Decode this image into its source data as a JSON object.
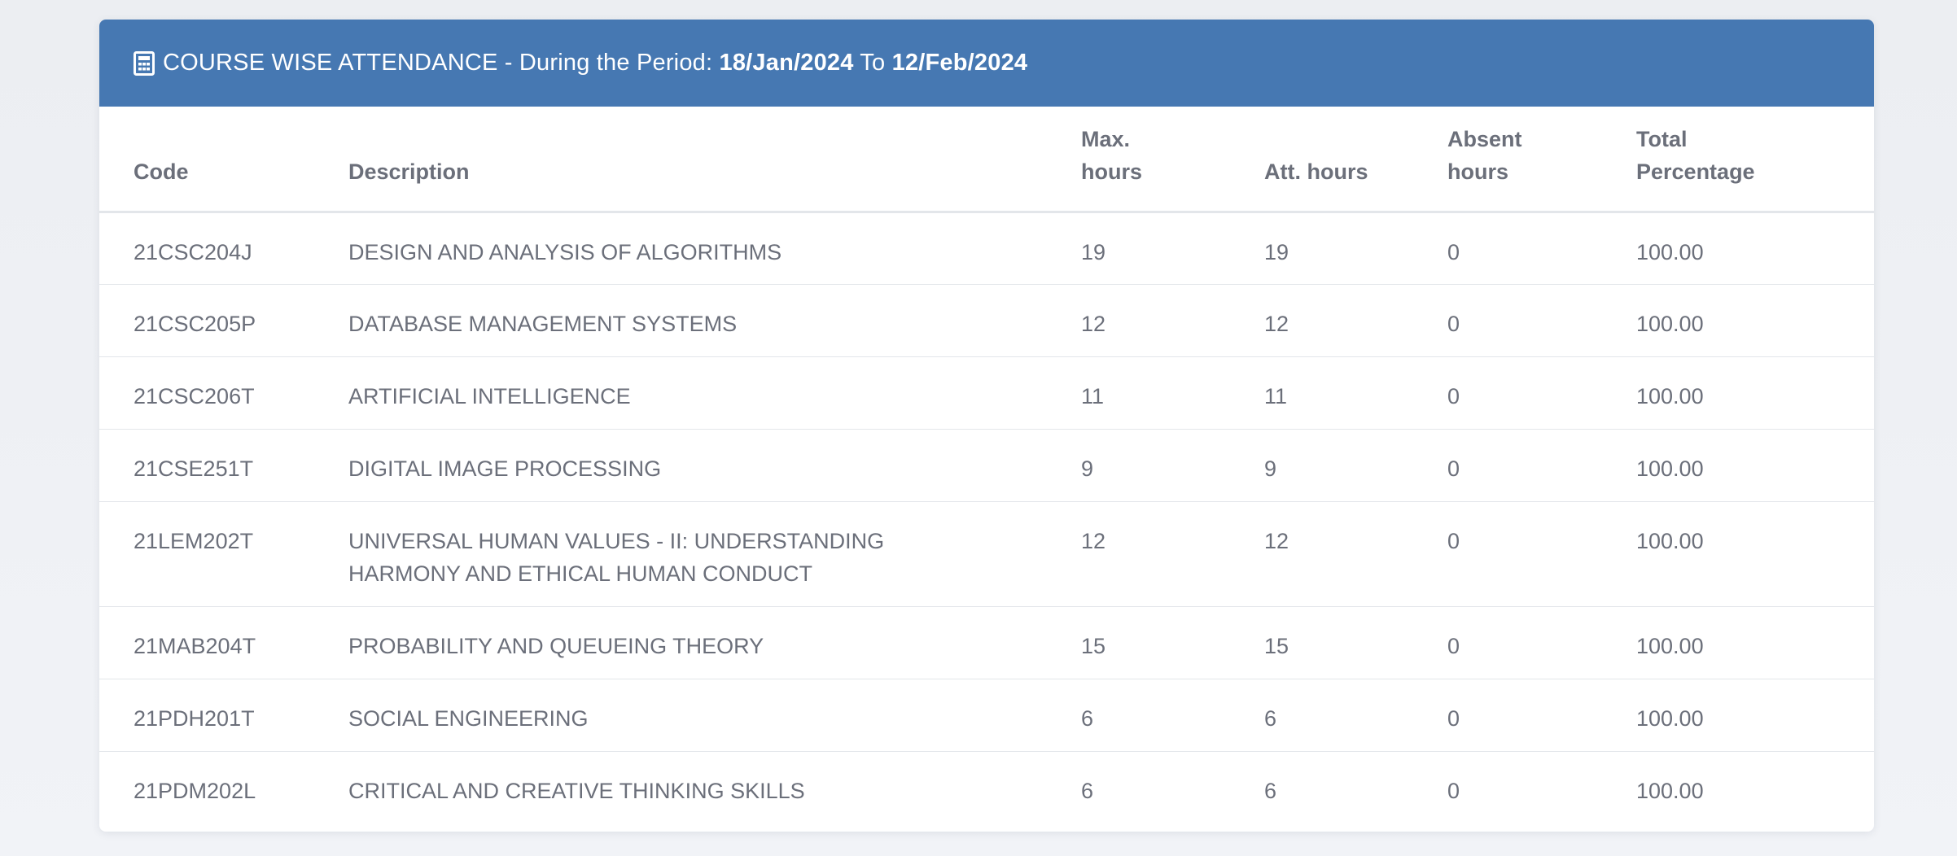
{
  "header": {
    "icon": "calculator-icon",
    "title_prefix": "COURSE WISE ATTENDANCE - During the Period: ",
    "from_date": "18/Jan/2024",
    "to_label": " To ",
    "to_date": "12/Feb/2024",
    "background_color": "#4678b2"
  },
  "table": {
    "columns": {
      "code": "Code",
      "description": "Description",
      "max_hours": "Max. hours",
      "att_hours": "Att. hours",
      "absent_hours": "Absent hours",
      "total_percentage": "Total Percentage"
    },
    "rows": [
      {
        "code": "21CSC204J",
        "description": "DESIGN AND ANALYSIS OF ALGORITHMS",
        "max_hours": "19",
        "att_hours": "19",
        "absent_hours": "0",
        "total_percentage": "100.00"
      },
      {
        "code": "21CSC205P",
        "description": "DATABASE MANAGEMENT SYSTEMS",
        "max_hours": "12",
        "att_hours": "12",
        "absent_hours": "0",
        "total_percentage": "100.00"
      },
      {
        "code": "21CSC206T",
        "description": "ARTIFICIAL INTELLIGENCE",
        "max_hours": "11",
        "att_hours": "11",
        "absent_hours": "0",
        "total_percentage": "100.00"
      },
      {
        "code": "21CSE251T",
        "description": "DIGITAL IMAGE PROCESSING",
        "max_hours": "9",
        "att_hours": "9",
        "absent_hours": "0",
        "total_percentage": "100.00"
      },
      {
        "code": "21LEM202T",
        "description": "UNIVERSAL HUMAN VALUES - II: UNDERSTANDING HARMONY AND ETHICAL HUMAN CONDUCT",
        "max_hours": "12",
        "att_hours": "12",
        "absent_hours": "0",
        "total_percentage": "100.00"
      },
      {
        "code": "21MAB204T",
        "description": "PROBABILITY AND QUEUEING THEORY",
        "max_hours": "15",
        "att_hours": "15",
        "absent_hours": "0",
        "total_percentage": "100.00"
      },
      {
        "code": "21PDH201T",
        "description": "SOCIAL ENGINEERING",
        "max_hours": "6",
        "att_hours": "6",
        "absent_hours": "0",
        "total_percentage": "100.00"
      },
      {
        "code": "21PDM202L",
        "description": "CRITICAL AND CREATIVE THINKING SKILLS",
        "max_hours": "6",
        "att_hours": "6",
        "absent_hours": "0",
        "total_percentage": "100.00"
      }
    ]
  }
}
